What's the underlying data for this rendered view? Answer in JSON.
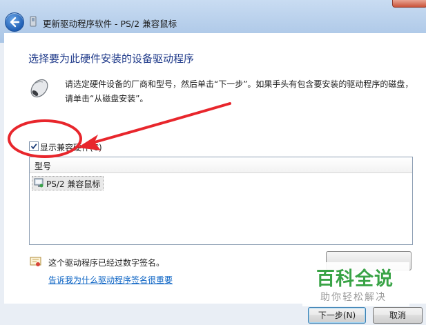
{
  "window": {
    "title": "更新驱动程序软件 - PS/2 兼容鼠标"
  },
  "page": {
    "heading": "选择要为此硬件安装的设备驱动程序",
    "description": "请选定硬件设备的厂商和型号，然后单击“下一步”。如果手头有包含要安装的驱动程序的磁盘，请单击“从磁盘安装”。",
    "show_compatible": {
      "label": "显示兼容硬件(C)",
      "checked": true
    },
    "model_list": {
      "header": "型号",
      "items": [
        "PS/2 兼容鼠标"
      ]
    },
    "signed_text": "这个驱动程序已经过数字签名。",
    "signing_link": "告诉我为什么驱动程序签名很重要",
    "have_disk_label": ""
  },
  "buttons": {
    "next": "下一步(N)",
    "cancel": "取消"
  },
  "watermark": {
    "main": "百科全说",
    "sub": "助你轻松解决"
  },
  "colors": {
    "heading": "#1f3a8a",
    "link": "#0b63c4",
    "annotation": "#e8262c",
    "watermark_green": "#39a346"
  },
  "icons": [
    "back-arrow-icon",
    "driver-icon",
    "mouse-icon",
    "checkmark-icon",
    "mouse-device-icon",
    "certificate-icon"
  ]
}
